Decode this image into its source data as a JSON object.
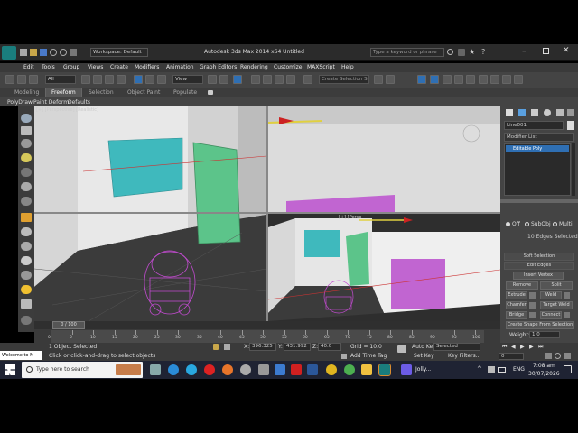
{
  "app": {
    "title": "Autodesk 3ds Max  2014 x64     Untitled",
    "workspace": "Workspace: Default",
    "search_placeholder": "Type a keyword or phrase"
  },
  "menu": [
    "Edit",
    "Tools",
    "Group",
    "Views",
    "Create",
    "Modifiers",
    "Animation",
    "Graph Editors",
    "Rendering",
    "Customize",
    "MAXScript",
    "Help"
  ],
  "toolbar": {
    "selection_filter": "All",
    "view_dropdown": "View",
    "named_selection": "Create Selection Se"
  },
  "ribbon": {
    "tabs": [
      "Modeling",
      "Freeform",
      "Selection",
      "Object Paint",
      "Populate"
    ],
    "active_tab": "Freeform",
    "sub_items": [
      "PolyDraw",
      "Paint Deform",
      "Defaults"
    ]
  },
  "viewport": {
    "label_topleft": "[+] [Perspective] [Realistic]",
    "label_bottomright": "[+] [Persp"
  },
  "command_panel": {
    "object_name": "Line001",
    "modifier_list": "Modifier List",
    "stack_item": "Editable Poly",
    "selection": {
      "off": "Off",
      "subobj": "SubObj",
      "multi": "Multi",
      "count": "10 Edges Selected"
    },
    "soft_selection": "Soft Selection",
    "edit_edges": "Edit Edges",
    "insert_vertex": "Insert Vertex",
    "buttons": [
      "Remove",
      "Split",
      "Extrude",
      "Weld",
      "Chamfer",
      "Target Weld",
      "Bridge",
      "Connect"
    ],
    "create_shape": "Create Shape From Selection",
    "weight_label": "Weight:",
    "weight_value": "1.0"
  },
  "timeline": {
    "frame": "0 / 100",
    "ticks": [
      "0",
      "5",
      "10",
      "15",
      "20",
      "25",
      "30",
      "35",
      "40",
      "45",
      "50",
      "55",
      "60",
      "65",
      "70",
      "75",
      "80",
      "85",
      "90",
      "95",
      "100"
    ]
  },
  "status": {
    "welcome": "Welcome to M",
    "objects": "1 Object Selected",
    "hint": "Click or click-and-drag to select objects",
    "x_label": "X:",
    "x_value": "396.325",
    "y_label": "Y:",
    "y_value": "431.992",
    "z_label": "Z:",
    "z_value": "40.0",
    "grid": "Grid = 10.0",
    "add_time_tag": "Add Time Tag",
    "auto_key": "Auto Key",
    "selected": "Selected",
    "set_key": "Set Key",
    "key_filters": "Key Filters...",
    "frame_field": "0"
  },
  "taskbar": {
    "search_placeholder": "Type here to search",
    "app_label": "Jolly...",
    "lang": "ENG",
    "time": "7:08 am",
    "date": "30/07/2026"
  },
  "colors": {
    "teal_panel": "#3fb9bd",
    "green_door": "#5cc48a",
    "magenta_panel": "#c165d1",
    "wall": "#e4e4e4",
    "ground": "#3b3b3b",
    "selection_blue": "#2f6fb3"
  }
}
